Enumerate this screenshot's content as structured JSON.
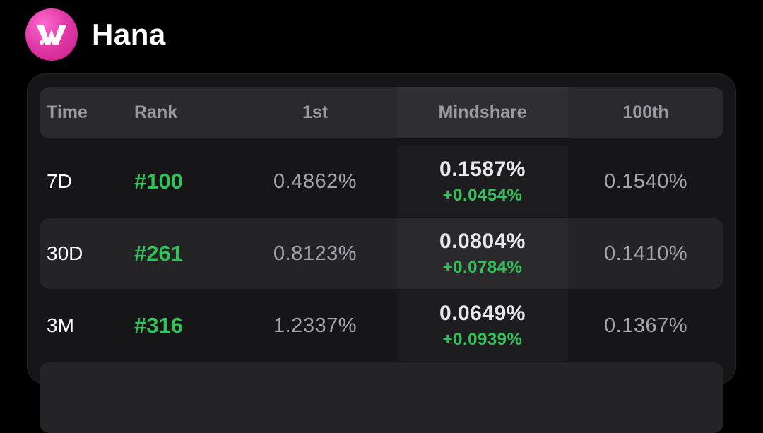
{
  "app": {
    "title": "Hana",
    "logo_icon": "hana-logo-icon",
    "logo_color": "#e23aa8"
  },
  "table": {
    "headers": {
      "time": "Time",
      "rank": "Rank",
      "first": "1st",
      "mindshare": "Mindshare",
      "hundredth": "100th"
    },
    "rows": [
      {
        "time": "7D",
        "rank": "#100",
        "first": "0.4862%",
        "mindshare": "0.1587%",
        "delta": "+0.0454%",
        "hundredth": "0.1540%"
      },
      {
        "time": "30D",
        "rank": "#261",
        "first": "0.8123%",
        "mindshare": "0.0804%",
        "delta": "+0.0784%",
        "hundredth": "0.1410%"
      },
      {
        "time": "3M",
        "rank": "#316",
        "first": "1.2337%",
        "mindshare": "0.0649%",
        "delta": "+0.0939%",
        "hundredth": "0.1367%"
      }
    ]
  },
  "colors": {
    "positive": "#33c25a",
    "background": "#000000",
    "panel": "#161618"
  }
}
